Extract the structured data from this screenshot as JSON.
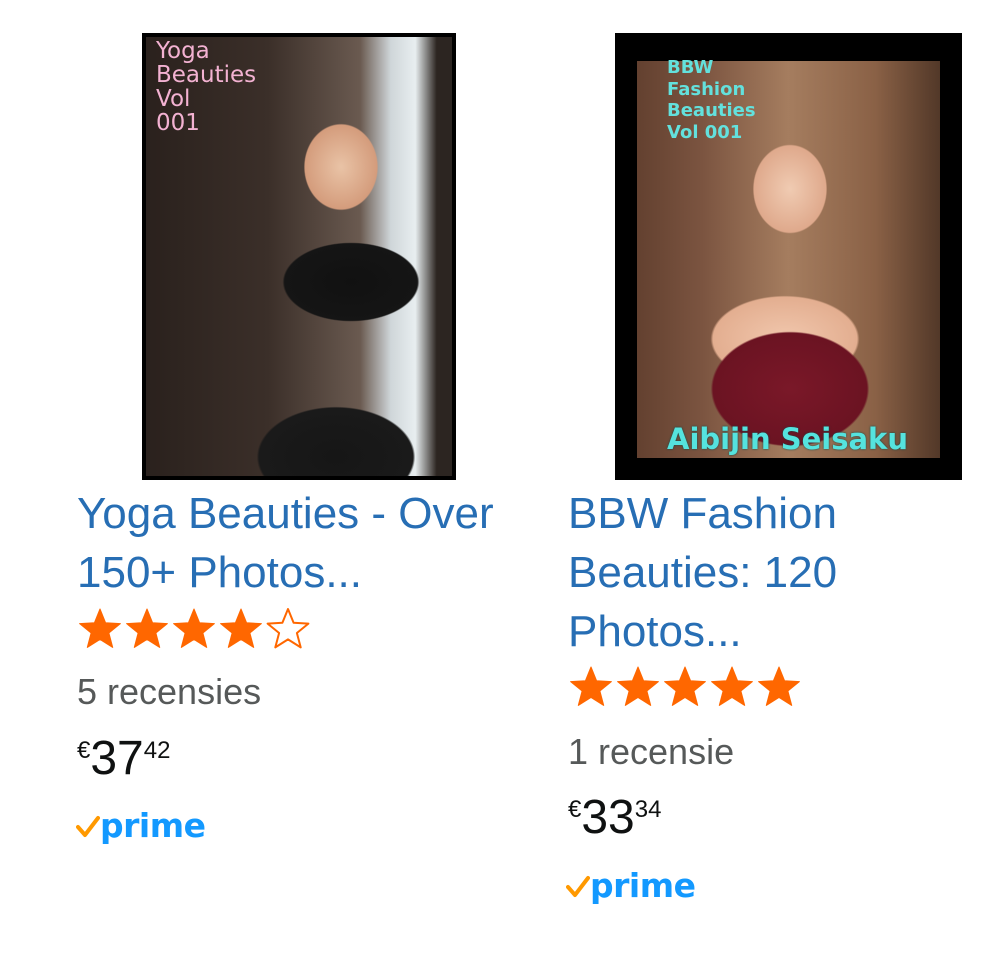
{
  "products": [
    {
      "cover": {
        "title": "Yoga\nBeauties\nVol\n001",
        "author": ""
      },
      "title": "Yoga Beauties - Over 150+ Photos...",
      "rating": 4,
      "stars_total": 5,
      "reviews": "5 recensies",
      "price": {
        "symbol": "€",
        "whole": "37",
        "fraction": "42"
      },
      "prime": "prime"
    },
    {
      "cover": {
        "title": "BBW\nFashion\nBeauties\nVol 001",
        "author": "Aibijin Seisaku"
      },
      "title": "BBW Fashion Beauties: 120 Photos...",
      "rating": 5,
      "stars_total": 5,
      "reviews": "1 recensie",
      "price": {
        "symbol": "€",
        "whole": "33",
        "fraction": "34"
      },
      "prime": "prime"
    }
  ],
  "colors": {
    "title_link": "#276eb4",
    "star": "#ff6700",
    "review_text": "#565959",
    "price": "#0f1111",
    "prime_check": "#ff9900",
    "prime_word": "#1399ff"
  },
  "icons": {
    "star_full": "star-filled-icon",
    "star_empty": "star-outline-icon",
    "prime_check": "checkmark-icon"
  }
}
